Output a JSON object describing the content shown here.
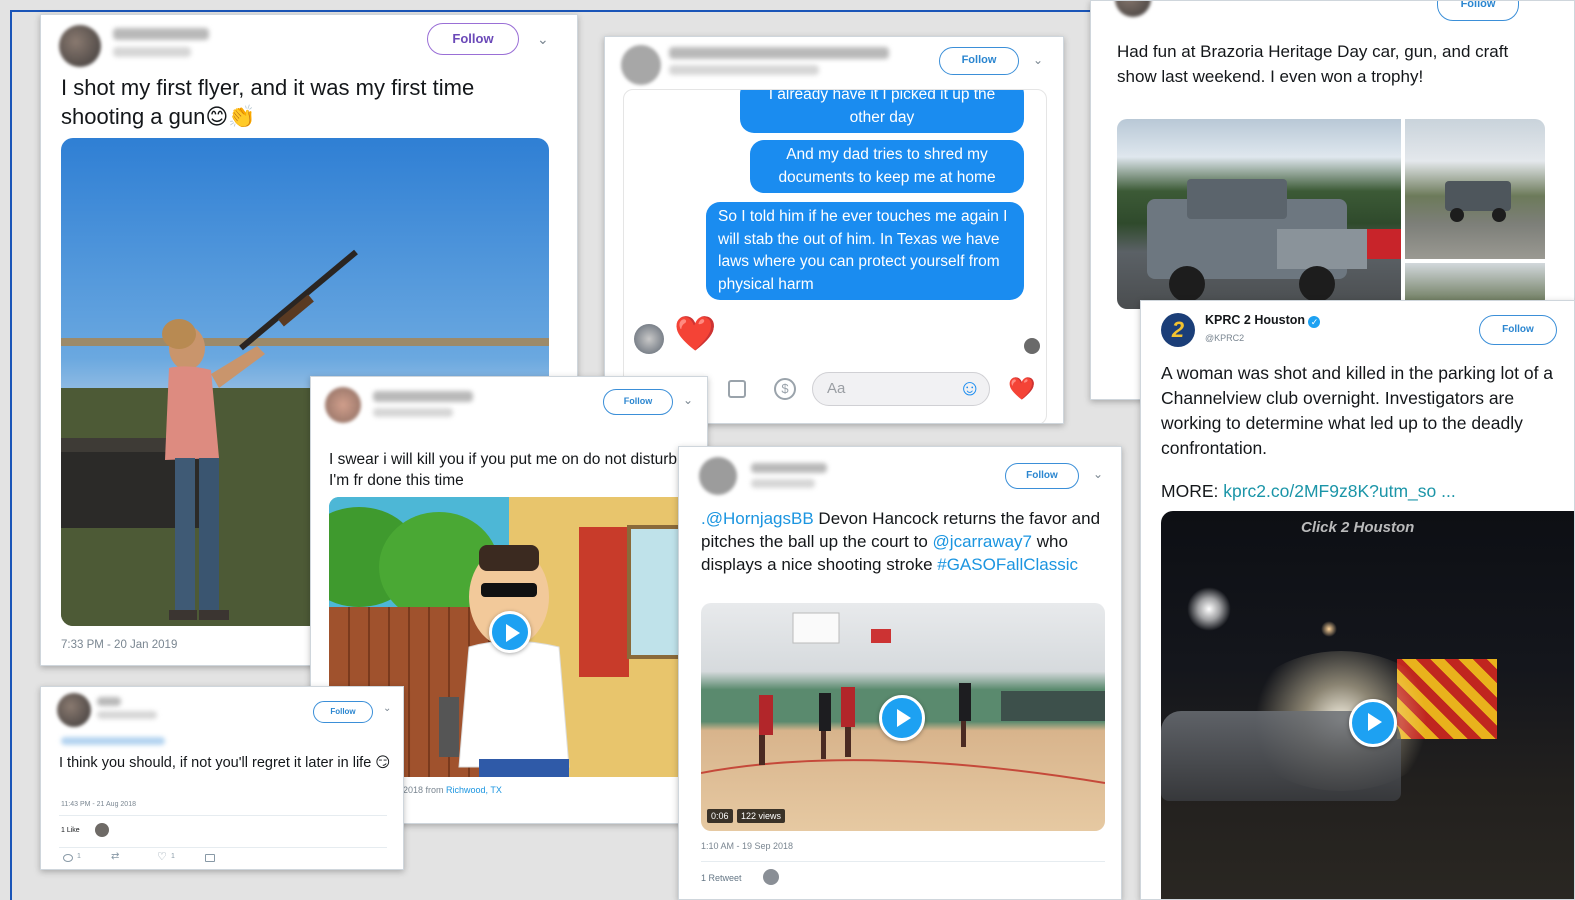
{
  "card_shooter": {
    "follow_label": "Follow",
    "text": "I shot my first flyer, and it was my first time shooting a gun",
    "emoji1": "😊",
    "emoji2": "👏",
    "timestamp": "7:33 PM - 20 Jan 2019"
  },
  "card_messenger": {
    "follow_label": "Follow",
    "bubbles": [
      "I already have it I picked it up the other day",
      "And my dad tries to shred my documents to keep me at home",
      "So I told him if he ever touches me again I will stab the        out of him. In Texas we have laws where you can protect yourself from physical harm"
    ],
    "heart": "❤️",
    "composer_placeholder": "Aa",
    "smile_icon": "☺",
    "dollar_icon": "$"
  },
  "card_car_show": {
    "follow_label": "Follow",
    "text": "Had fun at Brazoria Heritage Day car, gun, and craft show last weekend. I even won a trophy!"
  },
  "card_kprc": {
    "account_name": "KPRC 2 Houston",
    "handle": "@KPRC2",
    "logo_glyph": "2",
    "follow_label": "Follow",
    "text": "A woman was shot and killed in the parking lot of a Channelview club overnight. Investigators are working to determine what led up to the deadly confrontation.",
    "more_label": "MORE: ",
    "more_link": "kprc2.co/2MF9z8K?utm_so  ...",
    "video_brand": "Click 2 Houston"
  },
  "card_dnd": {
    "follow_label": "Follow",
    "text": "I swear i will kill you if you put me on do not disturb I'm fr done this time",
    "meta_partial": "2018 from ",
    "meta_location": "Richwood, TX"
  },
  "card_hoops": {
    "follow_label": "Follow",
    "mention1": ".@HornjagsBB",
    "text1": " Devon Hancock returns the favor and pitches the ball up the court to ",
    "mention2": "@jcarraway7",
    "text2": " who displays a nice shooting stroke ",
    "hashtag": "#GASOFallClassic",
    "video_time": "0:06",
    "video_views": "122 views",
    "timestamp": "1:10 AM - 19 Sep 2018",
    "retweets": "1 Retweet"
  },
  "card_regret": {
    "follow_label": "Follow",
    "text": "I think you should, if not you'll regret it later in life",
    "emoji": "😏",
    "timestamp": "11:43 PM - 21 Aug 2018",
    "likes": "1 Like",
    "reply_count": "1",
    "like_count": "1"
  },
  "colors": {
    "accent": "#1da1f2",
    "messenger_blue": "#1a8cf0",
    "frame": "#1a55b8",
    "heart": "#e0162b"
  }
}
